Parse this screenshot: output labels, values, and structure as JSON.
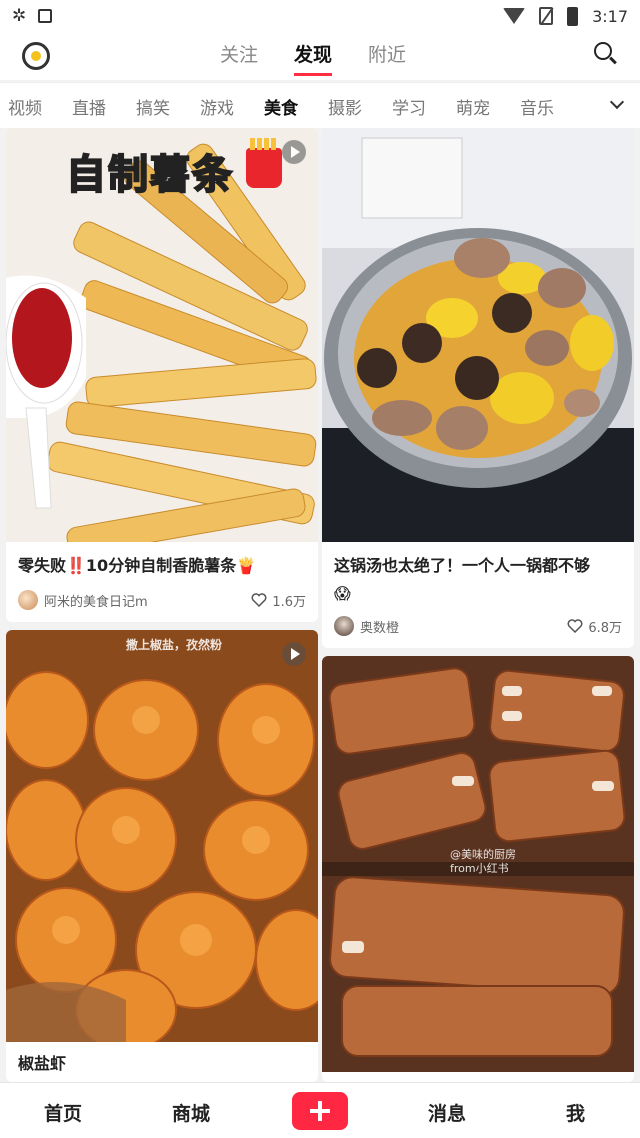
{
  "status_bar": {
    "left_icons": [
      "bug-icon",
      "notification-box-icon"
    ],
    "right_icons": [
      "wifi-icon",
      "no-sim-icon",
      "battery-icon"
    ],
    "time": "3:17"
  },
  "top_nav": {
    "tabs": [
      {
        "label": "关注",
        "active": false
      },
      {
        "label": "发现",
        "active": true
      },
      {
        "label": "附近",
        "active": false
      }
    ]
  },
  "category_bar": {
    "items": [
      {
        "label": "视频",
        "active": false
      },
      {
        "label": "直播",
        "active": false
      },
      {
        "label": "搞笑",
        "active": false
      },
      {
        "label": "游戏",
        "active": false
      },
      {
        "label": "美食",
        "active": true
      },
      {
        "label": "摄影",
        "active": false
      },
      {
        "label": "学习",
        "active": false
      },
      {
        "label": "萌宠",
        "active": false
      },
      {
        "label": "音乐",
        "active": false
      }
    ]
  },
  "feed": [
    {
      "overlay_text": "自制薯条",
      "is_video": true,
      "title": "零失败‼️10分钟自制香脆薯条🍟",
      "author": "阿米的美食日记m",
      "likes": "1.6万"
    },
    {
      "is_video": false,
      "title_line1": "这锅汤也太绝了！一个人一锅都不够",
      "title_line2": "😱",
      "author": "奥数橙",
      "likes": "6.8万"
    },
    {
      "overlay_text": "撒上椒盐，孜然粉",
      "is_video": true,
      "title": "椒盐虾"
    },
    {
      "overlay_text": "@美味的厨房 from小红书",
      "is_video": false
    }
  ],
  "bottom_nav": {
    "items": [
      "首页",
      "商城",
      "消息",
      "我"
    ],
    "post_icon": "plus-icon"
  },
  "colors": {
    "accent": "#ff2742",
    "active_underline": "#ff2d3f"
  }
}
